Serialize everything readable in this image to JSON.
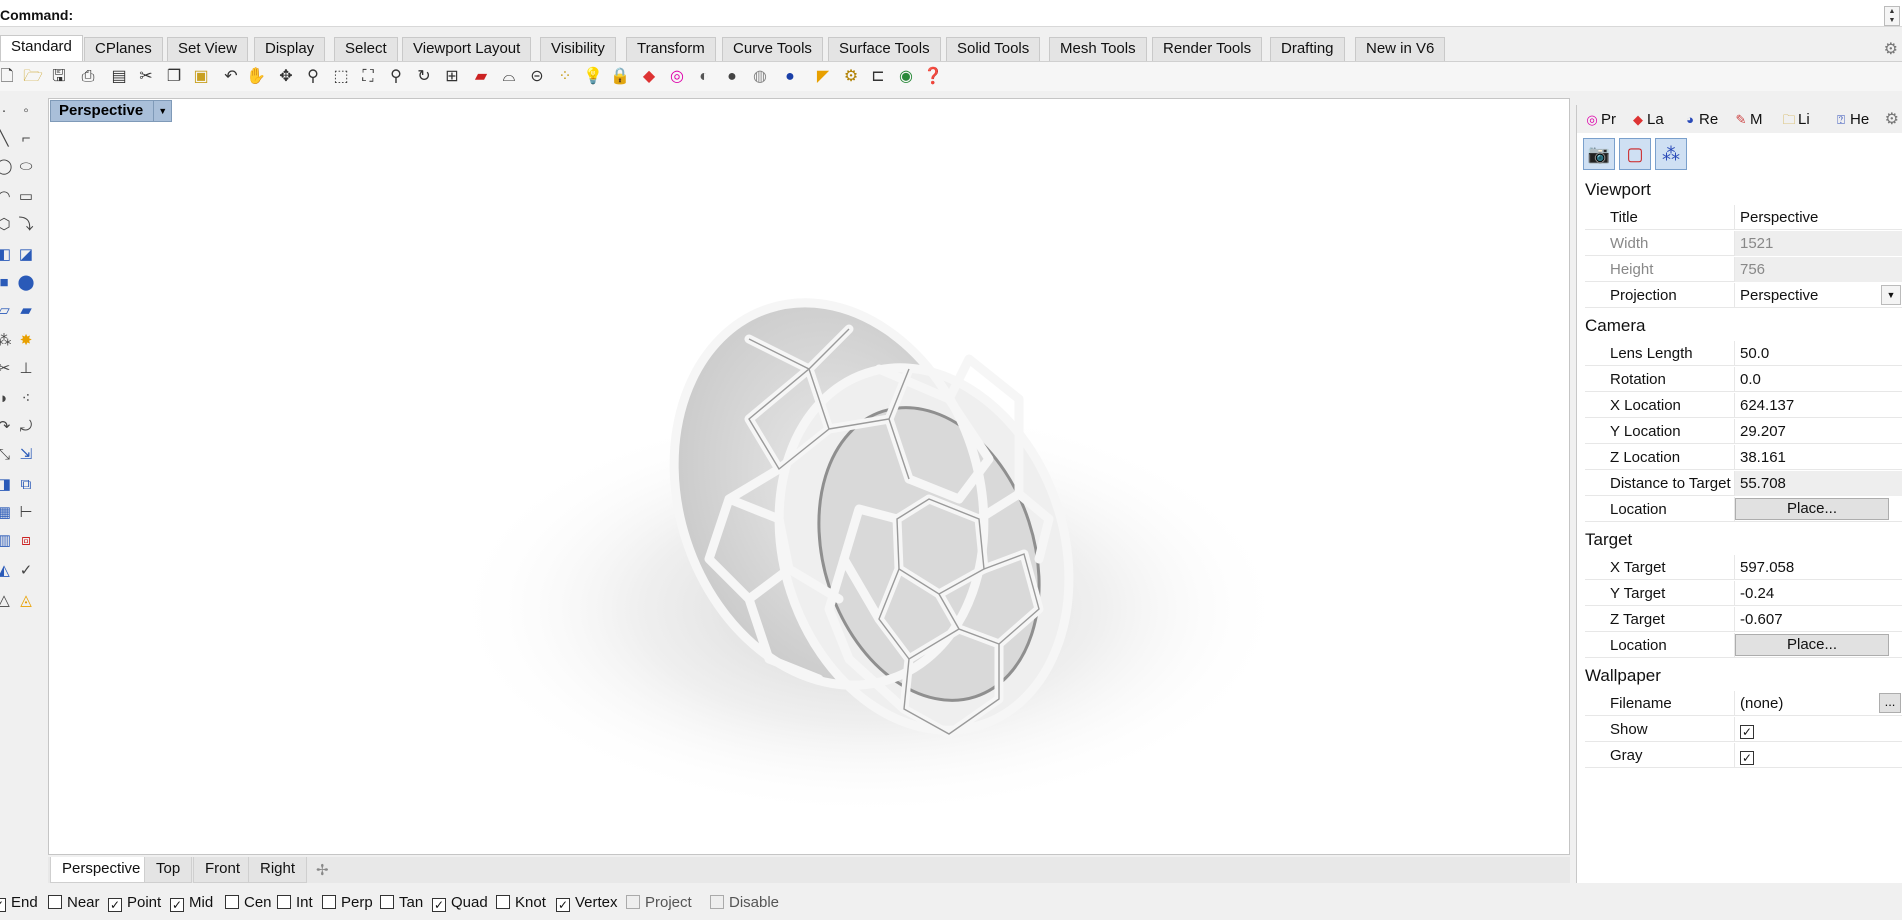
{
  "command": {
    "label": "Command:"
  },
  "top_tabs": [
    "Standard",
    "CPlanes",
    "Set View",
    "Display",
    "Select",
    "Viewport Layout",
    "Visibility",
    "Transform",
    "Curve Tools",
    "Surface Tools",
    "Solid Tools",
    "Mesh Tools",
    "Render Tools",
    "Drafting",
    "New in V6"
  ],
  "active_top_tab": "Standard",
  "toolbar_icons": [
    "new-icon",
    "open-icon",
    "save-icon",
    "print-icon",
    "import-icon",
    "cut-icon",
    "copy-icon",
    "paste-icon",
    "undo-icon",
    "pan-icon",
    "move-icon",
    "zoom-icon",
    "zoom-window-icon",
    "zoom-extents-icon",
    "zoom-selected-icon",
    "rotate-view-icon",
    "four-viewports-icon",
    "car-icon",
    "sweep-icon",
    "curve-icon",
    "points-icon",
    "light-icon",
    "lock-icon",
    "layer-icon",
    "color-wheel-icon",
    "shaded-sphere-icon",
    "rendered-sphere-icon",
    "material-sphere-icon",
    "blue-sphere-icon",
    "analyze-icon",
    "options-gear-icon",
    "dimension-icon",
    "globe-icon",
    "help-icon"
  ],
  "viewport": {
    "title": "Perspective"
  },
  "viewport_tabs": [
    "Perspective",
    "Top",
    "Front",
    "Right"
  ],
  "osnaps": [
    {
      "label": "End",
      "checked": true,
      "enabled": true
    },
    {
      "label": "Near",
      "checked": false,
      "enabled": true
    },
    {
      "label": "Point",
      "checked": true,
      "enabled": true
    },
    {
      "label": "Mid",
      "checked": true,
      "enabled": true
    },
    {
      "label": "Cen",
      "checked": false,
      "enabled": true
    },
    {
      "label": "Int",
      "checked": false,
      "enabled": true
    },
    {
      "label": "Perp",
      "checked": false,
      "enabled": true
    },
    {
      "label": "Tan",
      "checked": false,
      "enabled": true
    },
    {
      "label": "Quad",
      "checked": true,
      "enabled": true
    },
    {
      "label": "Knot",
      "checked": false,
      "enabled": true
    },
    {
      "label": "Vertex",
      "checked": true,
      "enabled": true
    },
    {
      "label": "Project",
      "checked": false,
      "enabled": false
    },
    {
      "label": "Disable",
      "checked": false,
      "enabled": false
    }
  ],
  "panel_tabs": [
    {
      "label": "Pr",
      "icon": "properties-icon"
    },
    {
      "label": "La",
      "icon": "layers-icon"
    },
    {
      "label": "Re",
      "icon": "render-icon"
    },
    {
      "label": "M",
      "icon": "materials-icon"
    },
    {
      "label": "Li",
      "icon": "libraries-icon"
    },
    {
      "label": "He",
      "icon": "help-icon"
    }
  ],
  "panel_icons": [
    "camera-icon",
    "frame-icon",
    "nodes-icon"
  ],
  "sections": {
    "viewport": {
      "heading": "Viewport",
      "rows": [
        {
          "label": "Title",
          "value": "Perspective"
        },
        {
          "label": "Width",
          "value": "1521"
        },
        {
          "label": "Height",
          "value": "756"
        },
        {
          "label": "Projection",
          "value": "Perspective"
        }
      ]
    },
    "camera": {
      "heading": "Camera",
      "rows": [
        {
          "label": "Lens Length",
          "value": "50.0"
        },
        {
          "label": "Rotation",
          "value": "0.0"
        },
        {
          "label": "X Location",
          "value": "624.137"
        },
        {
          "label": "Y Location",
          "value": "29.207"
        },
        {
          "label": "Z Location",
          "value": "38.161"
        },
        {
          "label": "Distance to Target",
          "value": "55.708"
        },
        {
          "label": "Location",
          "button": "Place..."
        }
      ]
    },
    "target": {
      "heading": "Target",
      "rows": [
        {
          "label": "X Target",
          "value": "597.058"
        },
        {
          "label": "Y Target",
          "value": "-0.24"
        },
        {
          "label": "Z Target",
          "value": "-0.607"
        },
        {
          "label": "Location",
          "button": "Place..."
        }
      ]
    },
    "wallpaper": {
      "heading": "Wallpaper",
      "rows": [
        {
          "label": "Filename",
          "value": "(none)",
          "ellipsis": "..."
        },
        {
          "label": "Show",
          "checked": true
        },
        {
          "label": "Gray",
          "checked": true
        }
      ]
    }
  }
}
